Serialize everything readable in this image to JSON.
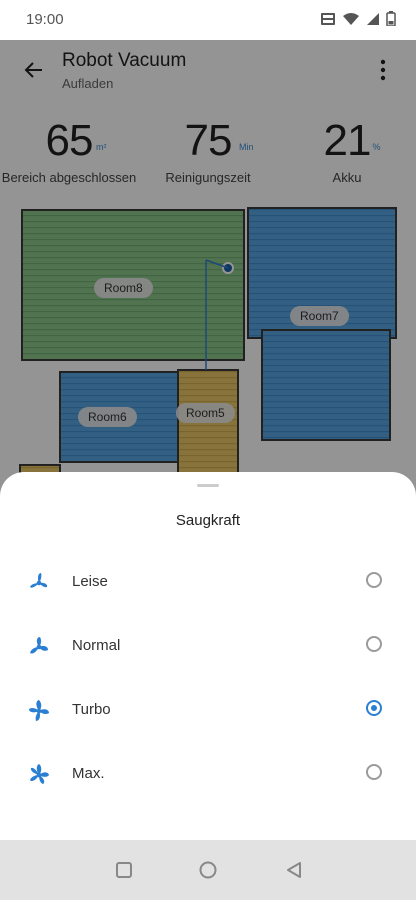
{
  "status_bar": {
    "time": "19:00",
    "icons": [
      "volte-icon",
      "wifi-icon",
      "signal-icon",
      "battery-icon"
    ]
  },
  "header": {
    "title": "Robot Vacuum",
    "subtitle": "Aufladen",
    "back_icon": "arrow-left-icon",
    "menu_icon": "more-vert-icon"
  },
  "stats": [
    {
      "value": "65",
      "unit": "m²",
      "label": "Bereich abgeschlossen"
    },
    {
      "value": "75",
      "unit": "Min",
      "label": "Reinigungszeit"
    },
    {
      "value": "21",
      "unit": "%",
      "label": "Akku"
    }
  ],
  "map": {
    "rooms": [
      "Room8",
      "Room7",
      "Room6",
      "Room5"
    ]
  },
  "sheet": {
    "title": "Saugkraft",
    "options": [
      {
        "label": "Leise",
        "selected": false,
        "icon": "fan-quiet-icon"
      },
      {
        "label": "Normal",
        "selected": false,
        "icon": "fan-normal-icon"
      },
      {
        "label": "Turbo",
        "selected": true,
        "icon": "fan-turbo-icon"
      },
      {
        "label": "Max.",
        "selected": false,
        "icon": "fan-max-icon"
      }
    ]
  },
  "navbar": {
    "buttons": [
      "recents-button",
      "home-button",
      "back-button"
    ]
  },
  "colors": {
    "accent": "#2b7fd3",
    "room_green": "#8cc68a",
    "room_blue": "#59a6e0",
    "room_yellow": "#e8c766"
  }
}
